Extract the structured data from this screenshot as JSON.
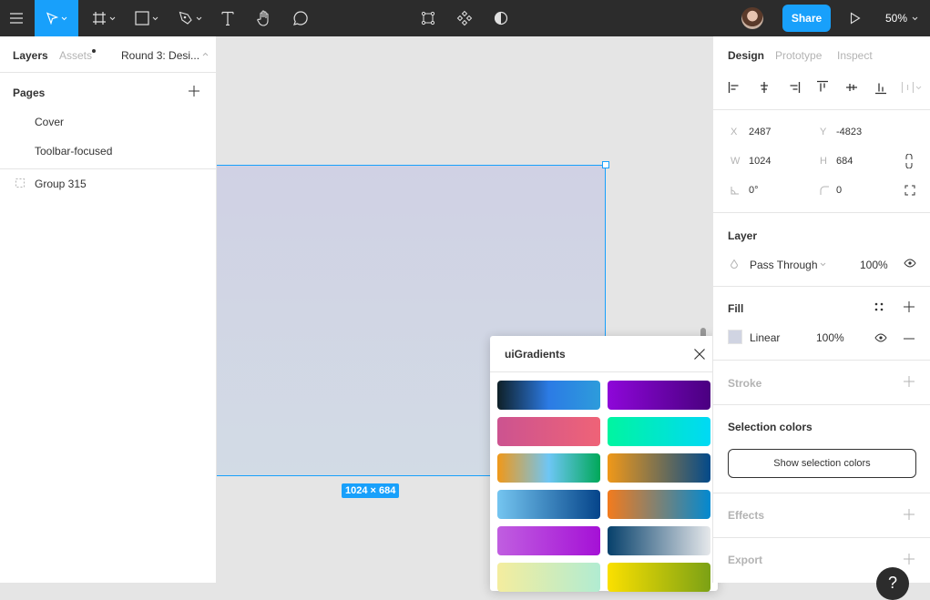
{
  "toolbar": {
    "tools": [
      "menu",
      "move",
      "frame",
      "shape",
      "pen",
      "text",
      "hand",
      "comment"
    ],
    "center_tools": [
      "edit-object",
      "components",
      "mask"
    ],
    "share_label": "Share",
    "zoom_level": "50%",
    "active_tool": "move",
    "accent": "#18a0fb"
  },
  "left_panel": {
    "tabs": {
      "layers": "Layers",
      "assets": "Assets"
    },
    "page_selector": "Round 3: Desi...",
    "pages_title": "Pages",
    "pages": [
      "Cover",
      "Toolbar-focused"
    ],
    "layers": [
      {
        "name": "Group 315",
        "type": "group"
      }
    ]
  },
  "canvas": {
    "frame_size_badge": "1024 × 684"
  },
  "plugin": {
    "title": "uiGradients",
    "gradients": [
      [
        "#0f2027",
        "#2c7be5",
        "#2d9cdb"
      ],
      [
        "#8e07d9",
        "#4a0080"
      ],
      [
        "#cc5390",
        "#ef6377"
      ],
      [
        "#00f5a0",
        "#00d9f5"
      ],
      [
        "#f09819",
        "#6ec6f5",
        "#00a859"
      ],
      [
        "#f09819",
        "#034a8a"
      ],
      [
        "#74c5f0",
        "#05448a"
      ],
      [
        "#f37b1d",
        "#0389d0"
      ],
      [
        "#c05ee0",
        "#a511d6"
      ],
      [
        "#06406b",
        "#e6e8eb"
      ],
      [
        "#f4ed9e",
        "#b1ecd2"
      ],
      [
        "#fbe000",
        "#7ba115"
      ]
    ]
  },
  "right_panel": {
    "tabs": {
      "design": "Design",
      "prototype": "Prototype",
      "inspect": "Inspect"
    },
    "props": {
      "x_label": "X",
      "x": "2487",
      "y_label": "Y",
      "y": "-4823",
      "w_label": "W",
      "w": "1024",
      "h_label": "H",
      "h": "684",
      "rotation": "0°",
      "radius": "0"
    },
    "layer": {
      "title": "Layer",
      "blend_mode": "Pass Through",
      "opacity": "100%"
    },
    "fill": {
      "title": "Fill",
      "type": "Linear",
      "opacity": "100%",
      "swatch": "#d0d4e2"
    },
    "stroke": {
      "title": "Stroke"
    },
    "selection_colors": {
      "title": "Selection colors",
      "button": "Show selection colors"
    },
    "effects": {
      "title": "Effects"
    },
    "export": {
      "title": "Export"
    }
  },
  "help": {
    "label": "?"
  }
}
